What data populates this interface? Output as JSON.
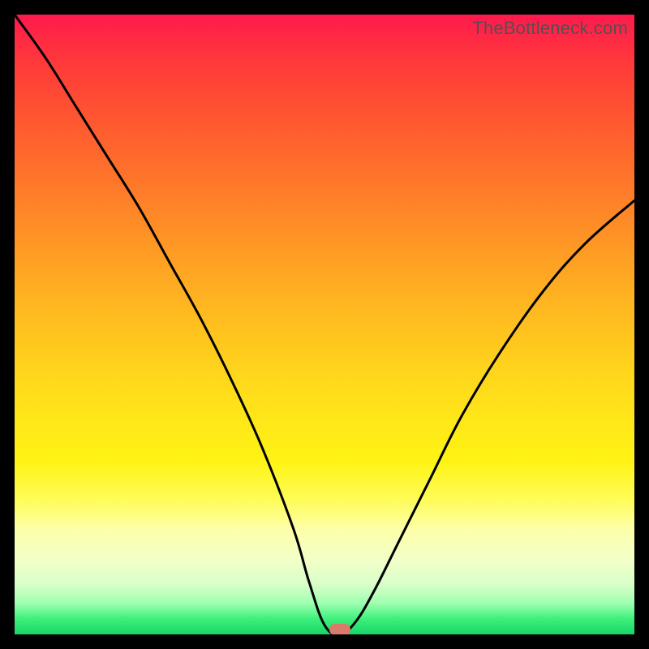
{
  "watermark_text": "TheBottleneck.com",
  "marker": {
    "x_frac": 0.525,
    "y_frac": 0.992
  },
  "chart_data": {
    "type": "line",
    "title": "",
    "xlabel": "",
    "ylabel": "",
    "xlim": [
      0,
      1
    ],
    "ylim": [
      0,
      1
    ],
    "series": [
      {
        "name": "bottleneck-curve",
        "x": [
          0.0,
          0.05,
          0.1,
          0.15,
          0.2,
          0.25,
          0.3,
          0.35,
          0.4,
          0.45,
          0.475,
          0.5,
          0.525,
          0.55,
          0.58,
          0.62,
          0.67,
          0.72,
          0.78,
          0.85,
          0.92,
          1.0
        ],
        "y": [
          1.0,
          0.93,
          0.85,
          0.77,
          0.69,
          0.6,
          0.51,
          0.41,
          0.3,
          0.17,
          0.085,
          0.015,
          0.0,
          0.02,
          0.07,
          0.15,
          0.25,
          0.35,
          0.45,
          0.55,
          0.63,
          0.7
        ]
      }
    ],
    "annotations": [
      {
        "type": "marker",
        "x": 0.525,
        "y": 0.0,
        "label": "optimal-point"
      }
    ],
    "background_gradient": {
      "top": "#ff1a4d",
      "mid": "#ffd61c",
      "bottom": "#18d468"
    }
  }
}
